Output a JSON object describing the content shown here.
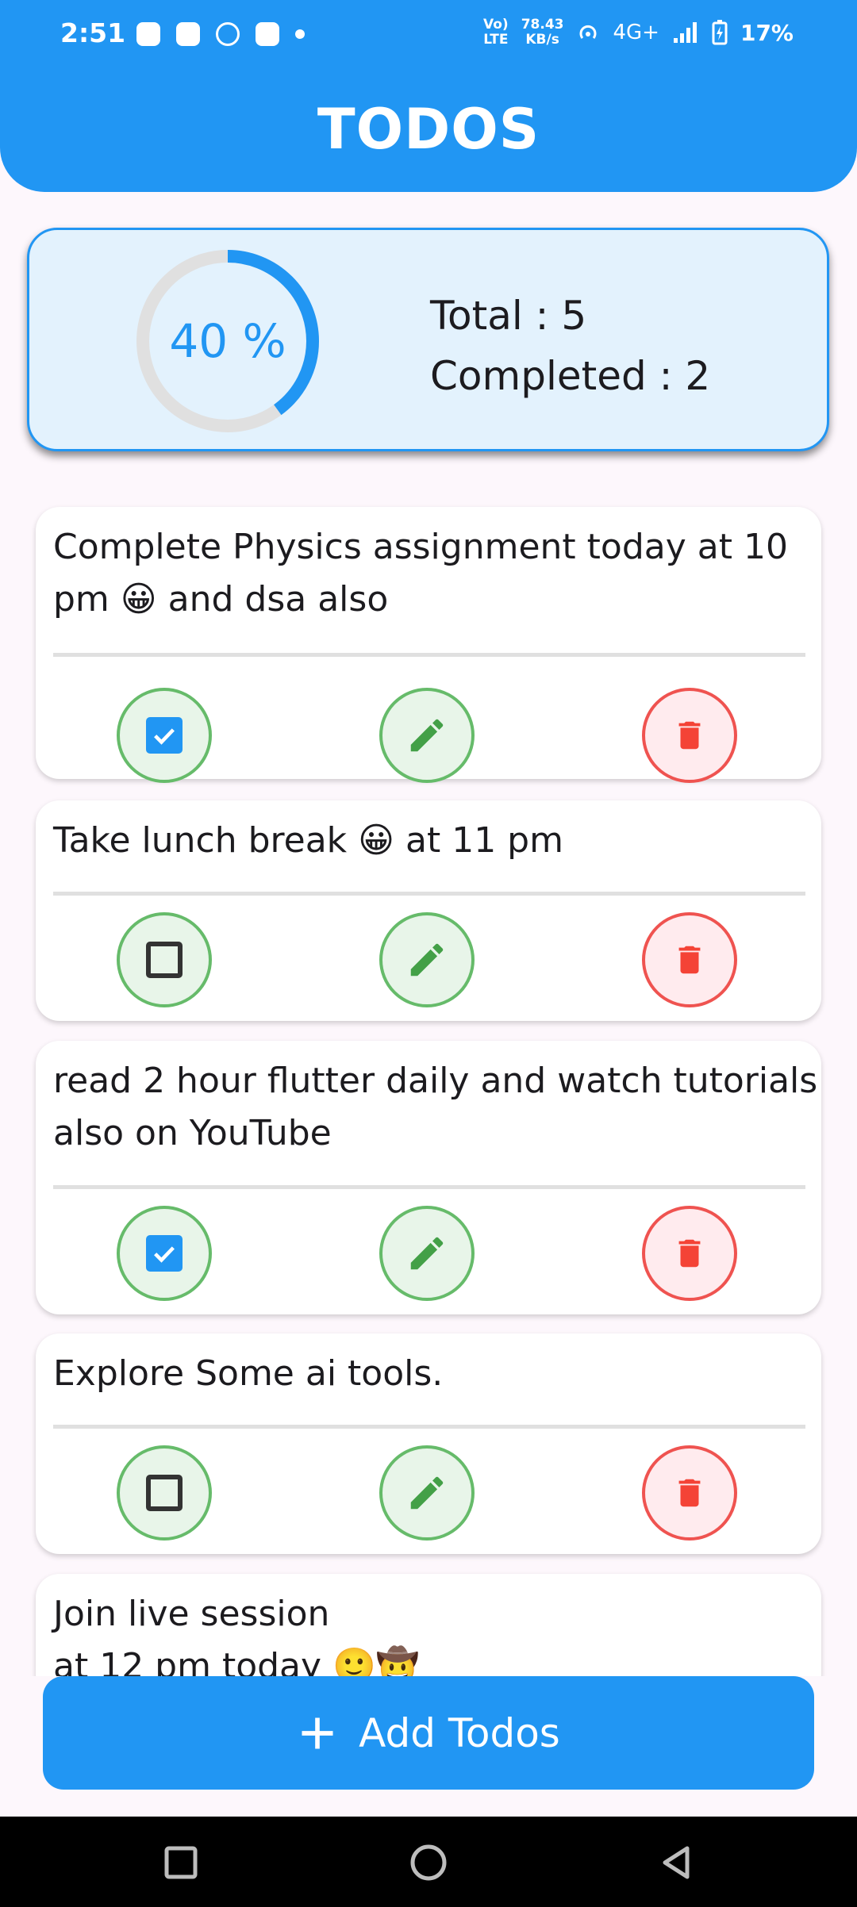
{
  "status_bar": {
    "time": "2:51",
    "network_speed_value": "78.43",
    "network_speed_unit": "KB/s",
    "volte": "Vo)",
    "lte": "LTE",
    "network_type": "4G+",
    "battery": "17%"
  },
  "app_bar": {
    "title": "TODOS"
  },
  "summary": {
    "progress_label": "40 %",
    "progress_fraction": 0.4,
    "total_text": "Total : 5",
    "completed_text": "Completed : 2"
  },
  "todos": [
    {
      "text": "Complete Physics assignment today at 10 pm 😀 and dsa also",
      "completed": true
    },
    {
      "text": "Take lunch break 😀 at 11 pm",
      "completed": false
    },
    {
      "text": "read 2 hour flutter daily and watch tutorials also on YouTube",
      "completed": true
    },
    {
      "text": "Explore Some ai tools.",
      "completed": false
    },
    {
      "line1": "Join live session",
      "line2": "at 12 pm today 🙂🤠"
    }
  ],
  "add_button": {
    "label": "Add Todos",
    "icon": "plus-icon"
  },
  "colors": {
    "primary": "#2196f3",
    "summary_bg": "#e3f2fd",
    "edit_green": "#43a047",
    "delete_red": "#f44336",
    "background": "#fdf7fc"
  }
}
